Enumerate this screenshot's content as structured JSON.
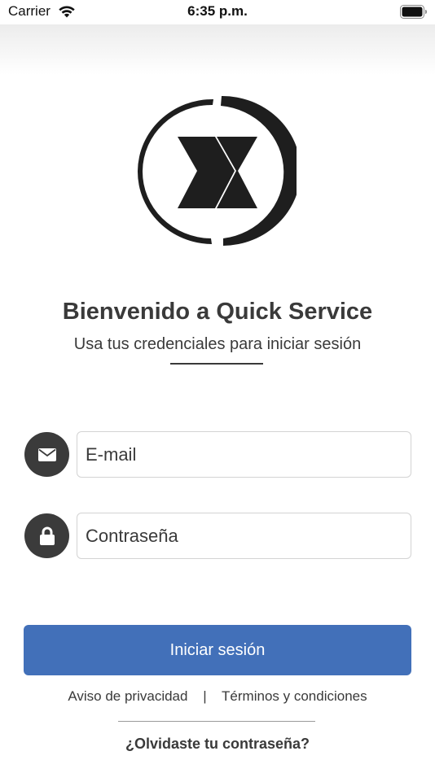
{
  "status_bar": {
    "carrier": "Carrier",
    "time": "6:35 p.m."
  },
  "header": {
    "logo_icon": "quick-service-x-logo"
  },
  "welcome": {
    "title": "Bienvenido a Quick Service",
    "subtitle": "Usa tus credenciales para iniciar sesión"
  },
  "form": {
    "email": {
      "placeholder": "E-mail",
      "value": "",
      "icon": "envelope-icon"
    },
    "password": {
      "placeholder": "Contraseña",
      "value": "",
      "icon": "lock-icon"
    },
    "submit_label": "Iniciar sesión"
  },
  "footer": {
    "privacy_label": "Aviso de privacidad",
    "separator": "|",
    "terms_label": "Términos y condiciones",
    "forgot_label": "¿Olvidaste tu contraseña?"
  },
  "colors": {
    "primary_button": "#4270b9",
    "icon_circle": "#3b3b3b",
    "text": "#3a3a3a"
  }
}
